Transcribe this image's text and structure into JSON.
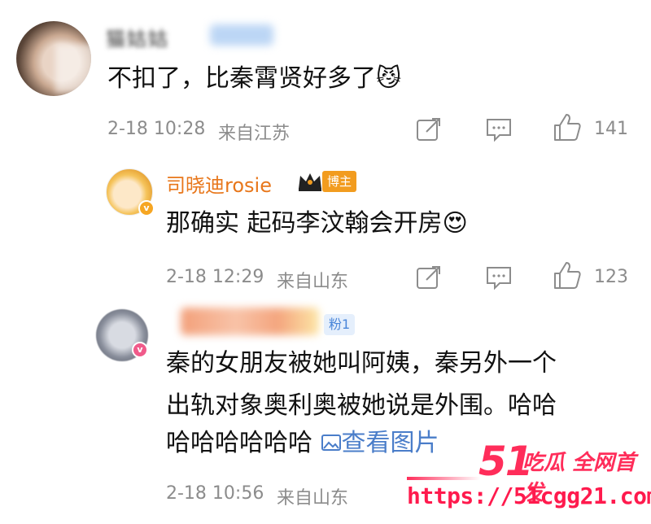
{
  "comments": [
    {
      "username": "猫姑姑",
      "text": "不扣了，比秦霄贤好多了",
      "emoji": "😼",
      "time": "2-18 10:28",
      "location": "来自江苏",
      "likes": "141"
    },
    {
      "username": "司晓迪rosie",
      "author_badge": "博主",
      "text": "那确实 起码李汶翰会开房",
      "emoji": "😍",
      "time": "2-18 12:29",
      "location": "来自山东",
      "likes": "123"
    },
    {
      "username": "粉丝",
      "fan_badge": "粉1",
      "text_line1": "秦的女朋友被她叫阿姨，秦另外一个",
      "text_line2": "出轨对象奥利奥被她说是外围。哈哈",
      "text_line3": "哈哈哈哈哈哈",
      "image_link": "查看图片",
      "time": "2-18 10:56",
      "location": "来自山东"
    }
  ],
  "watermark": {
    "number": "51",
    "slogan": "吃瓜 全网首发",
    "url": "https://51cgg21.com"
  },
  "colors": {
    "author_name": "#e8771b",
    "meta_gray": "#8c8c8c",
    "link_blue": "#4a7dc9",
    "watermark_red": "#ff2d5a"
  },
  "icons": [
    "share-icon",
    "comment-icon",
    "like-icon",
    "image-icon",
    "crown-icon",
    "verified-icon"
  ]
}
